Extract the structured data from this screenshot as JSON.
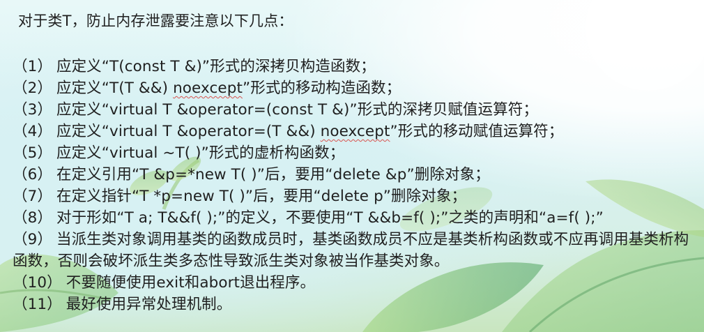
{
  "intro": "对于类T，防止内存泄露要注意以下几点：",
  "items": [
    {
      "num": "（1）",
      "pre": "应定义“T(const T &)”形式的深拷贝构造函数；",
      "flag": "",
      "post": ""
    },
    {
      "num": "（2）",
      "pre": "应定义“T(T &&) ",
      "flag": "noexcept",
      "post": "”形式的移动构造函数；"
    },
    {
      "num": "（3）",
      "pre": "应定义“virtual T &operator=(const T &)”形式的深拷贝赋值运算符；",
      "flag": "",
      "post": ""
    },
    {
      "num": "（4）",
      "pre": "应定义“virtual T &operator=(T &&) ",
      "flag": "noexcept",
      "post": "”形式的移动赋值运算符；"
    },
    {
      "num": "（5）",
      "pre": "应定义“virtual ~T( )”形式的虚析构函数；",
      "flag": "",
      "post": ""
    },
    {
      "num": "（6）",
      "pre": "在定义引用“T &p=*new T( )”后，要用“delete &p”删除对象；",
      "flag": "",
      "post": ""
    },
    {
      "num": "（7）",
      "pre": "在定义指针“T *p=new T( )”后，要用“delete p”删除对象；",
      "flag": "",
      "post": ""
    },
    {
      "num": "（8）",
      "pre": "对于形如“T a; T&&f( );”的定义，不要使用“T &&b=f( );”之类的声明和“a=f( );”",
      "flag": "",
      "post": ""
    },
    {
      "num": "（9）",
      "pre": "当派生类对象调用基类的函数成员时，基类函数成员不应是基类析构函数或不应再调用基类析构函数，否则会破坏派生类多态性导致派生类对象被当作基类对象。",
      "flag": "",
      "post": ""
    },
    {
      "num": "（10）",
      "pre": "不要随便使用exit和abort退出程序。",
      "flag": "",
      "post": ""
    },
    {
      "num": "（11）",
      "pre": "最好使用异常处理机制。",
      "flag": "",
      "post": ""
    }
  ]
}
